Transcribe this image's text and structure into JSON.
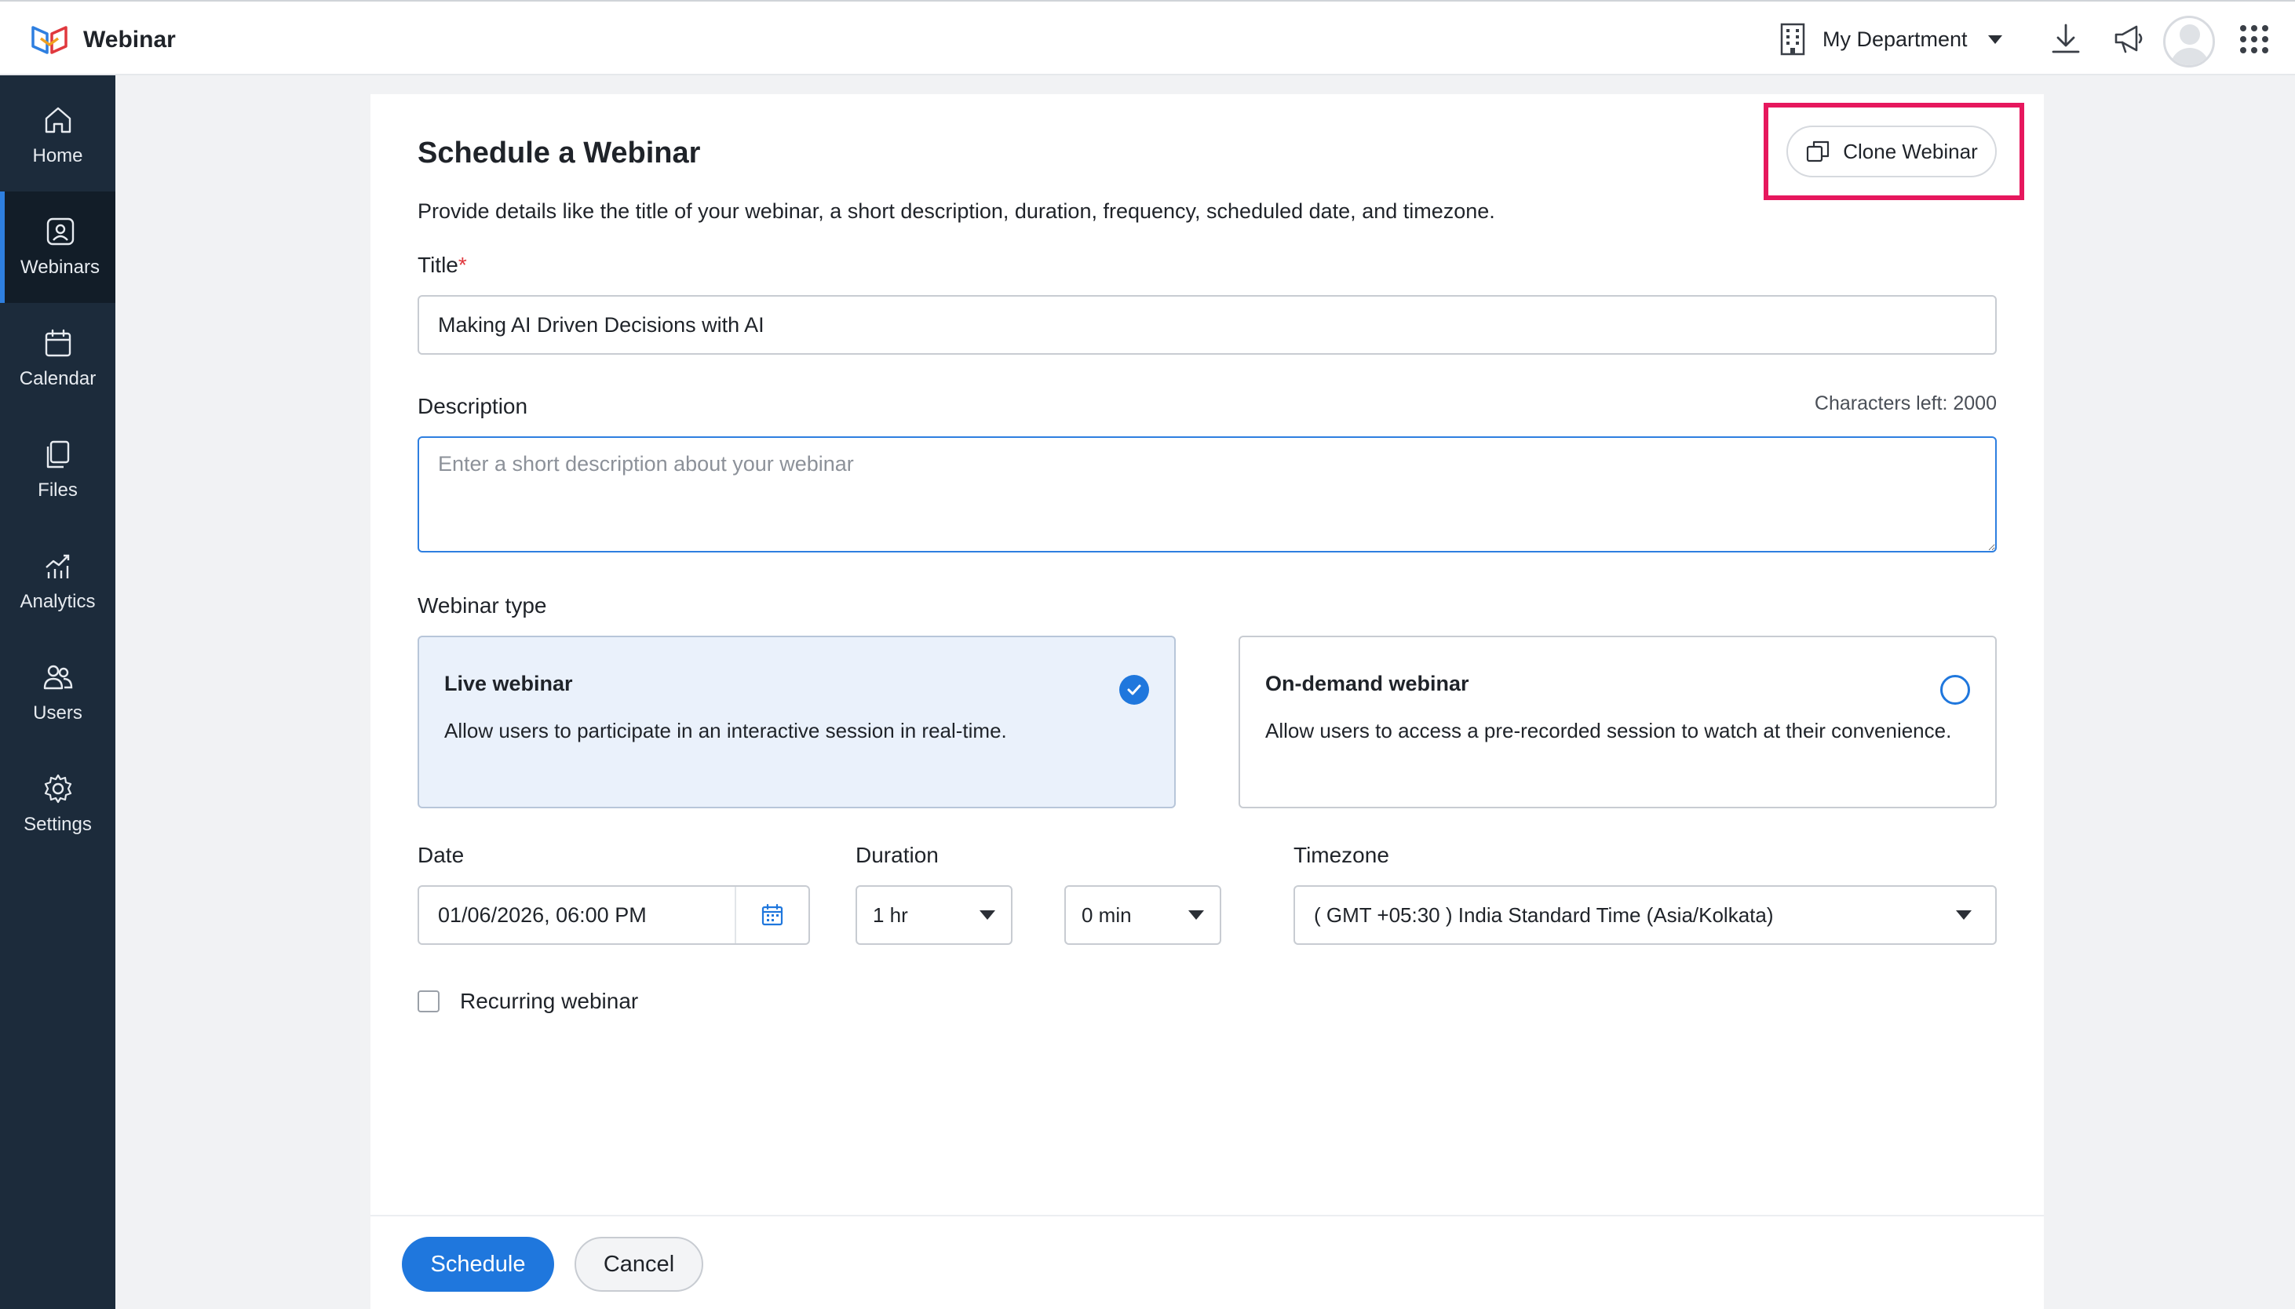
{
  "app": {
    "name": "Webinar"
  },
  "header": {
    "department": "My Department",
    "icons": [
      "building-icon",
      "download-icon",
      "megaphone-icon",
      "avatar",
      "apps-grid-icon"
    ]
  },
  "sidebar": {
    "items": [
      {
        "label": "Home",
        "icon": "home-icon"
      },
      {
        "label": "Webinars",
        "icon": "webinar-icon",
        "active": true
      },
      {
        "label": "Calendar",
        "icon": "calendar-icon"
      },
      {
        "label": "Files",
        "icon": "files-icon"
      },
      {
        "label": "Analytics",
        "icon": "analytics-icon"
      },
      {
        "label": "Users",
        "icon": "users-icon"
      },
      {
        "label": "Settings",
        "icon": "settings-icon"
      }
    ]
  },
  "form": {
    "title": "Schedule a Webinar",
    "description": "Provide details like the title of your webinar, a short description, duration, frequency, scheduled date, and timezone.",
    "clone_button": "Clone Webinar",
    "title_label": "Title",
    "required_mark": "*",
    "title_value": "Making AI Driven Decisions with AI",
    "description_label": "Description",
    "characters_left": "Characters left: 2000",
    "description_placeholder": "Enter a short description about your webinar",
    "webinar_type_label": "Webinar type",
    "types": [
      {
        "title": "Live webinar",
        "desc": "Allow users to participate in an interactive session in real-time.",
        "selected": true
      },
      {
        "title": "On-demand webinar",
        "desc": "Allow users to access a pre-recorded session to watch at their convenience.",
        "selected": false
      }
    ],
    "date_label": "Date",
    "date_value": "01/06/2026, 06:00 PM",
    "duration_label": "Duration",
    "duration_hours": "1 hr",
    "duration_minutes": "0 min",
    "timezone_label": "Timezone",
    "timezone_value": "( GMT +05:30 ) India Standard Time (Asia/Kolkata)",
    "recurring_label": "Recurring webinar",
    "recurring_checked": false
  },
  "footer": {
    "schedule": "Schedule",
    "cancel": "Cancel"
  },
  "colors": {
    "primary": "#1f77dd",
    "sidebar_bg": "#1c2b3b",
    "highlight": "#e6175d"
  }
}
